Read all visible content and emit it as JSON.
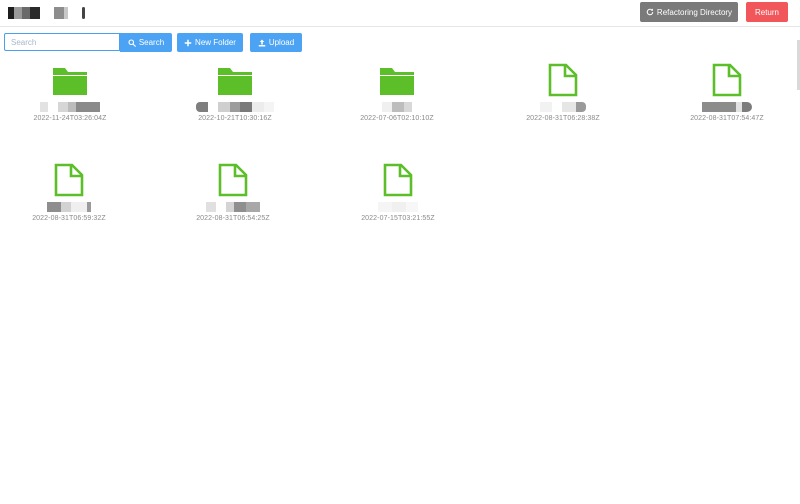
{
  "header": {
    "refactor_label": "Refactoring Directory",
    "return_label": "Return"
  },
  "toolbar": {
    "search_placeholder": "Search",
    "search_label": "Search",
    "new_folder_label": "New Folder",
    "upload_label": "Upload"
  },
  "items": [
    {
      "type": "folder",
      "date": "2022-11-24T03:26:04Z"
    },
    {
      "type": "folder",
      "date": "2022-10-21T10:30:16Z"
    },
    {
      "type": "folder",
      "date": "2022-07-06T02:10:10Z"
    },
    {
      "type": "file",
      "date": "2022-08-31T06:28:38Z"
    },
    {
      "type": "file",
      "date": "2022-08-31T07:54:47Z"
    },
    {
      "type": "file",
      "date": "2022-08-31T06:59:32Z"
    },
    {
      "type": "file",
      "date": "2022-08-31T06:54:25Z"
    },
    {
      "type": "file",
      "date": "2022-07-15T03:21:55Z"
    }
  ],
  "colors": {
    "accent": "#4ca3f3",
    "icon_green": "#5cbf2a",
    "return_red": "#f0565a",
    "refactor_gray": "#7a7a7a"
  }
}
